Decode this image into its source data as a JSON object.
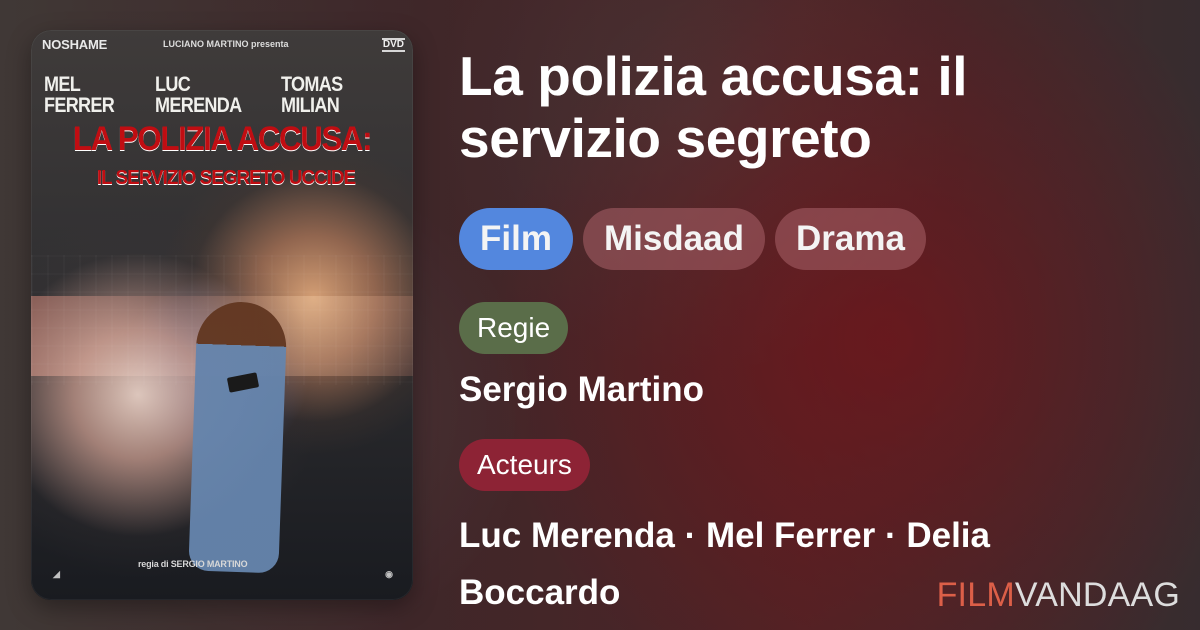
{
  "movie": {
    "title": "La polizia accusa: il servizio segreto",
    "genres": [
      "Film",
      "Misdaad",
      "Drama"
    ],
    "director_label": "Regie",
    "director": "Sergio Martino",
    "actors_label": "Acteurs",
    "actors": "Luc Merenda · Mel Ferrer · Delia Boccardo"
  },
  "poster": {
    "brand": "NOSHAME",
    "producer": "LUCIANO MARTINO presenta",
    "format": "DVD",
    "cast": [
      "MEL FERRER",
      "LUC MERENDA",
      "TOMAS MILIAN"
    ],
    "title_main": "LA POLIZIA ACCUSA:",
    "title_sub": "IL SERVIZIO SEGRETO UCCIDE",
    "credit": "regia di SERGIO MARTINO"
  },
  "brand": {
    "prefix": "FILM",
    "suffix": "VANDAAG"
  },
  "colors": {
    "genre_active": "#5387de",
    "genre_inactive": "#a65f65",
    "director_label": "#5a6d49",
    "actors_label": "#8d2335",
    "brand_prefix": "#dc5f48",
    "brand_suffix": "#dddddd"
  }
}
